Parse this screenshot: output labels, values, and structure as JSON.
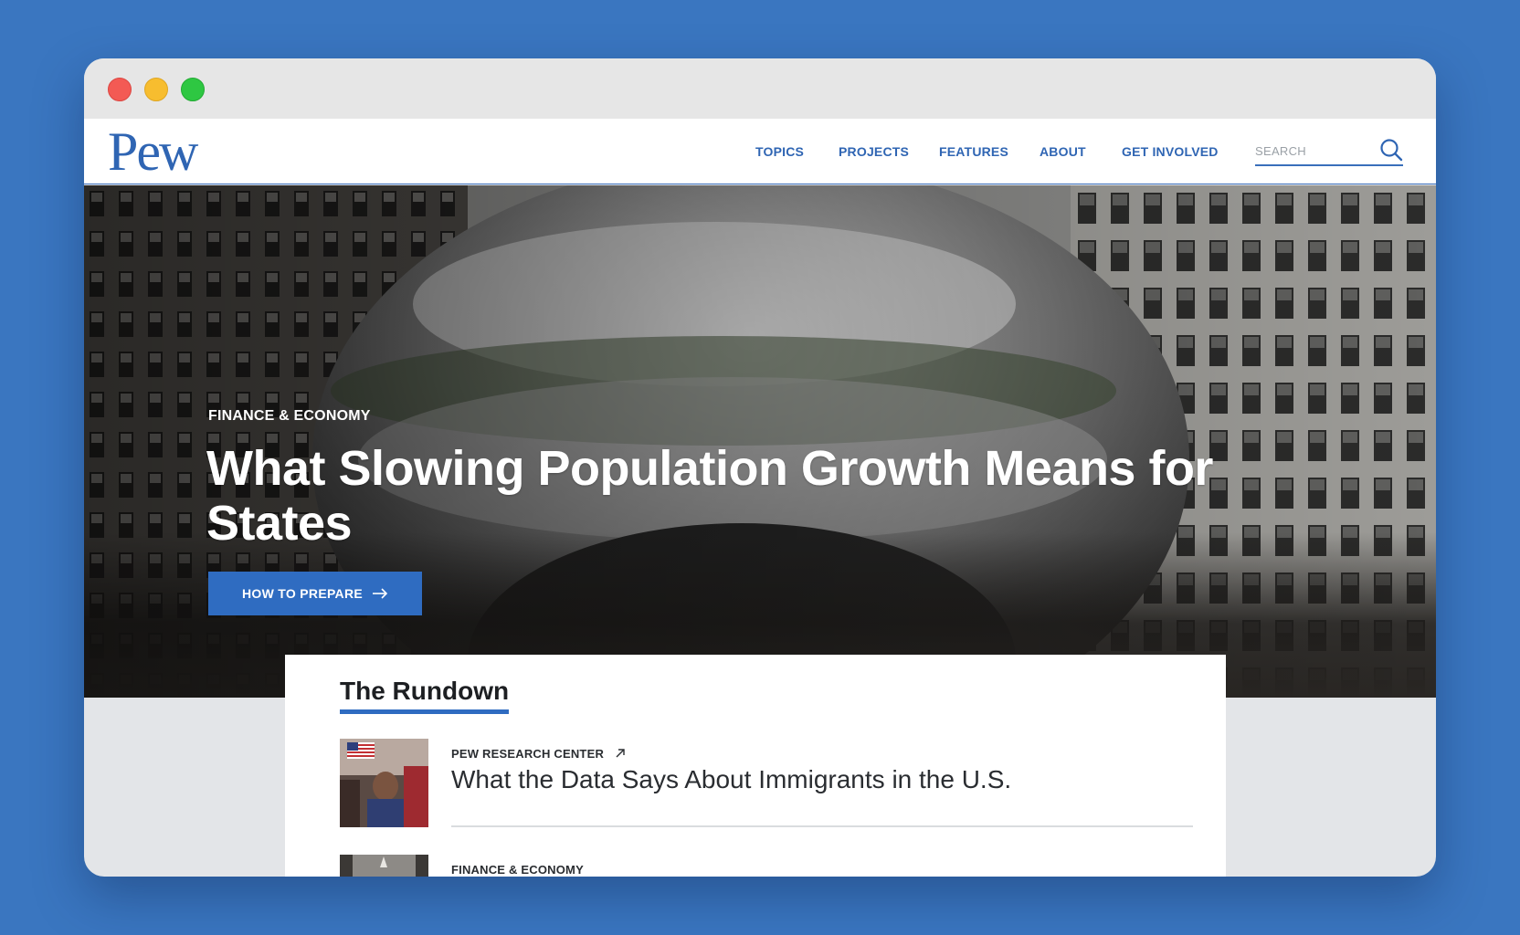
{
  "header": {
    "logo": "Pew",
    "nav": [
      "TOPICS",
      "PROJECTS",
      "FEATURES",
      "ABOUT",
      "GET INVOLVED"
    ],
    "search_placeholder": "SEARCH"
  },
  "hero": {
    "category": "FINANCE & ECONOMY",
    "title": "What Slowing Population Growth Means for States",
    "cta_label": "HOW TO PREPARE"
  },
  "rundown": {
    "heading": "The Rundown",
    "items": [
      {
        "category": "PEW RESEARCH CENTER",
        "title": "What the Data Says About Immigrants in the U.S.",
        "external": true
      },
      {
        "category": "FINANCE & ECONOMY",
        "title": ""
      }
    ]
  },
  "colors": {
    "brand_blue": "#2f65b3",
    "button_blue": "#2f6cc1",
    "page_background": "#3a76c0"
  },
  "icons": [
    "search-icon",
    "arrow-right-icon",
    "external-link-icon"
  ]
}
